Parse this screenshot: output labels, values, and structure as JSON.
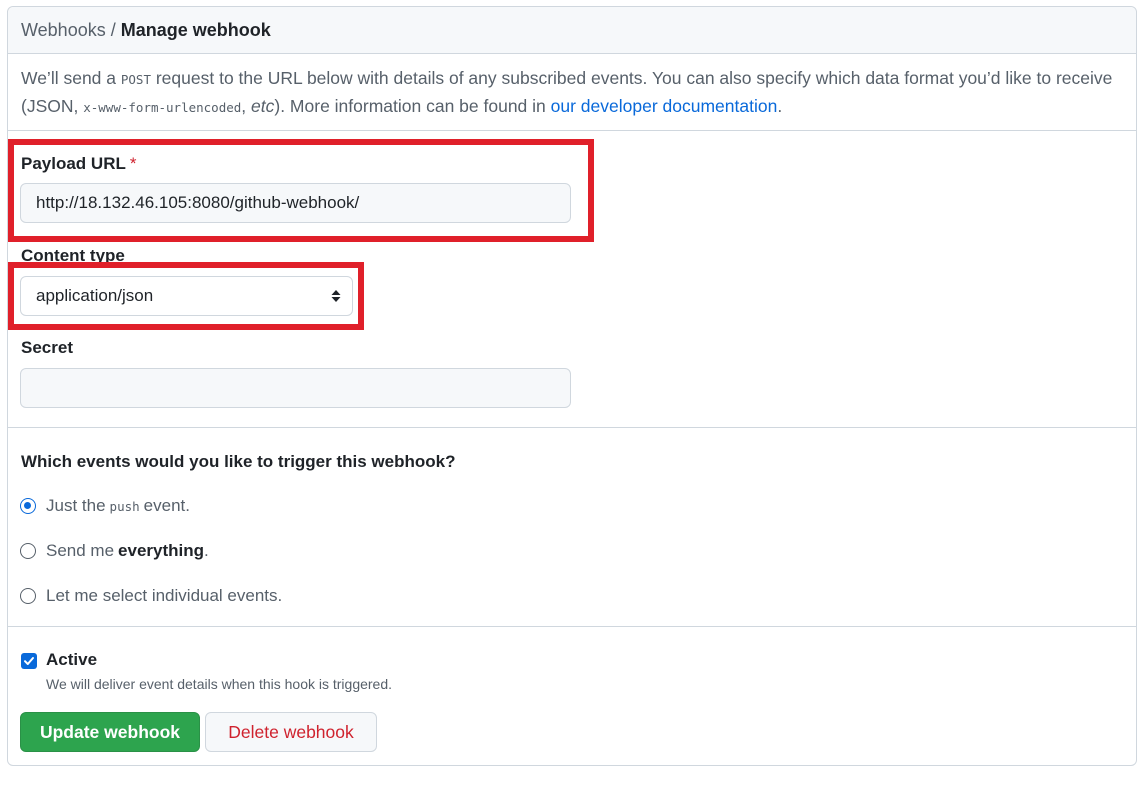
{
  "breadcrumb": {
    "parent": "Webhooks",
    "separator": "/",
    "current": "Manage webhook"
  },
  "intro": {
    "part1": "We’ll send a ",
    "code1": "POST",
    "part2": " request to the URL below with details of any subscribed events. You can also specify which data format you’d like to receive (JSON, ",
    "code2": "x-www-form-urlencoded",
    "part3": ", ",
    "italic": "etc",
    "part4": "). More information can be found in ",
    "link": "our developer documentation",
    "part5": "."
  },
  "payload_url": {
    "label": "Payload URL",
    "required_mark": "*",
    "value": "http://18.132.46.105:8080/github-webhook/"
  },
  "content_type": {
    "label": "Content type",
    "selected": "application/json"
  },
  "secret": {
    "label": "Secret",
    "value": ""
  },
  "events": {
    "question": "Which events would you like to trigger this webhook?",
    "option_push_prefix": "Just the",
    "option_push_code": "push",
    "option_push_suffix": "event.",
    "option_everything_prefix": "Send me",
    "option_everything_bold": "everything",
    "option_everything_suffix": ".",
    "option_individual": "Let me select individual events.",
    "selected": "push"
  },
  "active": {
    "label": "Active",
    "checked": true,
    "note": "We will deliver event details when this hook is triggered."
  },
  "buttons": {
    "update": "Update webhook",
    "delete": "Delete webhook"
  },
  "colors": {
    "highlight": "#e0202a",
    "primary": "#2da44e",
    "danger": "#cf222e",
    "link": "#0969da"
  }
}
